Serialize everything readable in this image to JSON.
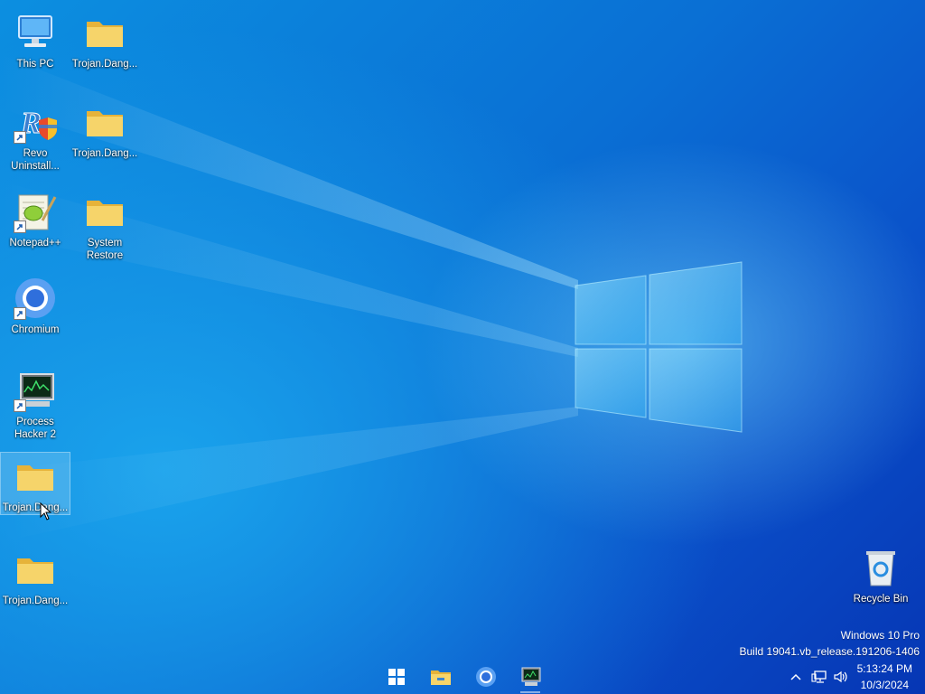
{
  "desktop": {
    "icons": [
      {
        "label": "This PC",
        "icon": "computer-icon"
      },
      {
        "label": "Trojan.Dang...",
        "icon": "folder-icon"
      },
      {
        "label": "Revo Uninstall...",
        "icon": "revo-uninstaller-icon"
      },
      {
        "label": "Trojan.Dang...",
        "icon": "folder-icon"
      },
      {
        "label": "Notepad++",
        "icon": "notepad-plus-plus-icon"
      },
      {
        "label": "System Restore",
        "icon": "folder-icon"
      },
      {
        "label": "Chromium",
        "icon": "chromium-icon"
      },
      {
        "label": "Process Hacker 2",
        "icon": "process-hacker-icon"
      },
      {
        "label": "Trojan.Dang...",
        "icon": "folder-icon"
      },
      {
        "label": "Trojan.Dang...",
        "icon": "folder-icon"
      },
      {
        "label": "Recycle Bin",
        "icon": "recycle-bin-icon"
      }
    ]
  },
  "watermark": {
    "edition": "Windows 10 Pro",
    "build": "Build 19041.vb_release.191206-1406"
  },
  "taskbar": {
    "pinned": [
      "start-icon",
      "file-explorer-icon",
      "chromium-icon",
      "process-hacker-icon"
    ],
    "tray_icons": [
      "chevron-up-icon",
      "network-icon",
      "volume-icon"
    ],
    "clock": {
      "time": "5:13:24 PM",
      "date": "10/3/2024"
    }
  },
  "colors": {
    "accent": "#0a6fd4",
    "folder": "#f3c64a"
  }
}
